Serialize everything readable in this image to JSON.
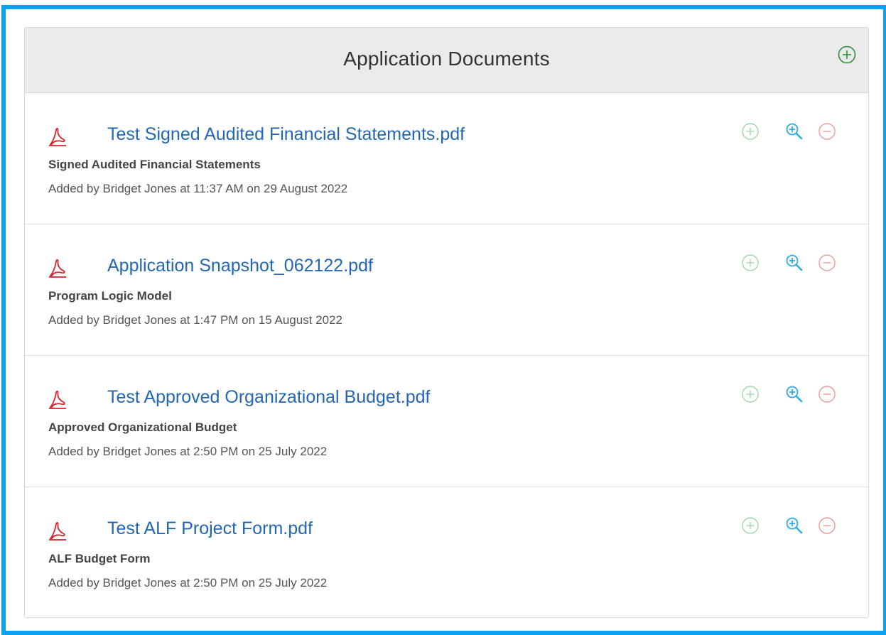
{
  "panel": {
    "title": "Application Documents",
    "add_icon": "plus-circle-icon"
  },
  "colors": {
    "frame_border": "#0ba0f0",
    "header_background": "#ebebeb",
    "link": "#2366b4",
    "add_action": "#5cb85c",
    "zoom_action": "#2aaee0",
    "remove_action": "#e06a6a",
    "pdf_icon": "#d9232e"
  },
  "documents": [
    {
      "file_name": "Test Signed Audited Financial Statements.pdf",
      "document_type": "Signed Audited Financial Statements",
      "added_text": "Added by Bridget Jones at 11:37 AM on 29 August 2022",
      "file_icon": "pdf-file-icon",
      "actions": [
        "plus-circle-icon",
        "zoom-in-icon",
        "minus-circle-icon"
      ]
    },
    {
      "file_name": "Application Snapshot_062122.pdf",
      "document_type": "Program Logic Model",
      "added_text": "Added by Bridget Jones at 1:47 PM on 15 August 2022",
      "file_icon": "pdf-file-icon",
      "actions": [
        "plus-circle-icon",
        "zoom-in-icon",
        "minus-circle-icon"
      ]
    },
    {
      "file_name": "Test Approved Organizational Budget.pdf",
      "document_type": "Approved Organizational Budget",
      "added_text": "Added by Bridget Jones at 2:50 PM on 25 July 2022",
      "file_icon": "pdf-file-icon",
      "actions": [
        "plus-circle-icon",
        "zoom-in-icon",
        "minus-circle-icon"
      ]
    },
    {
      "file_name": "Test ALF Project Form.pdf",
      "document_type": "ALF Budget Form",
      "added_text": "Added by Bridget Jones at 2:50 PM on 25 July 2022",
      "file_icon": "pdf-file-icon",
      "actions": [
        "plus-circle-icon",
        "zoom-in-icon",
        "minus-circle-icon"
      ]
    }
  ]
}
